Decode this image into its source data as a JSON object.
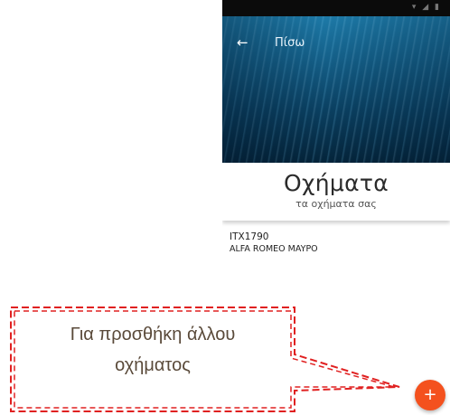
{
  "statusbar": {
    "icons": "▾ ◢ ▮"
  },
  "header": {
    "back_icon": "arrow-left-icon",
    "back_label": "Πίσω"
  },
  "title_card": {
    "title": "Οχήματα",
    "subtitle": "τα οχήματα σας"
  },
  "vehicles": [
    {
      "plate": "ITX1790",
      "description": "ALFA ROMEO MAYPO"
    }
  ],
  "fab": {
    "icon": "plus-icon",
    "label": "+",
    "color": "#f4511e"
  },
  "annotation": {
    "text_line1": "Για προσθήκη άλλου",
    "text_line2": "οχήματος",
    "border_color": "#e02020"
  }
}
